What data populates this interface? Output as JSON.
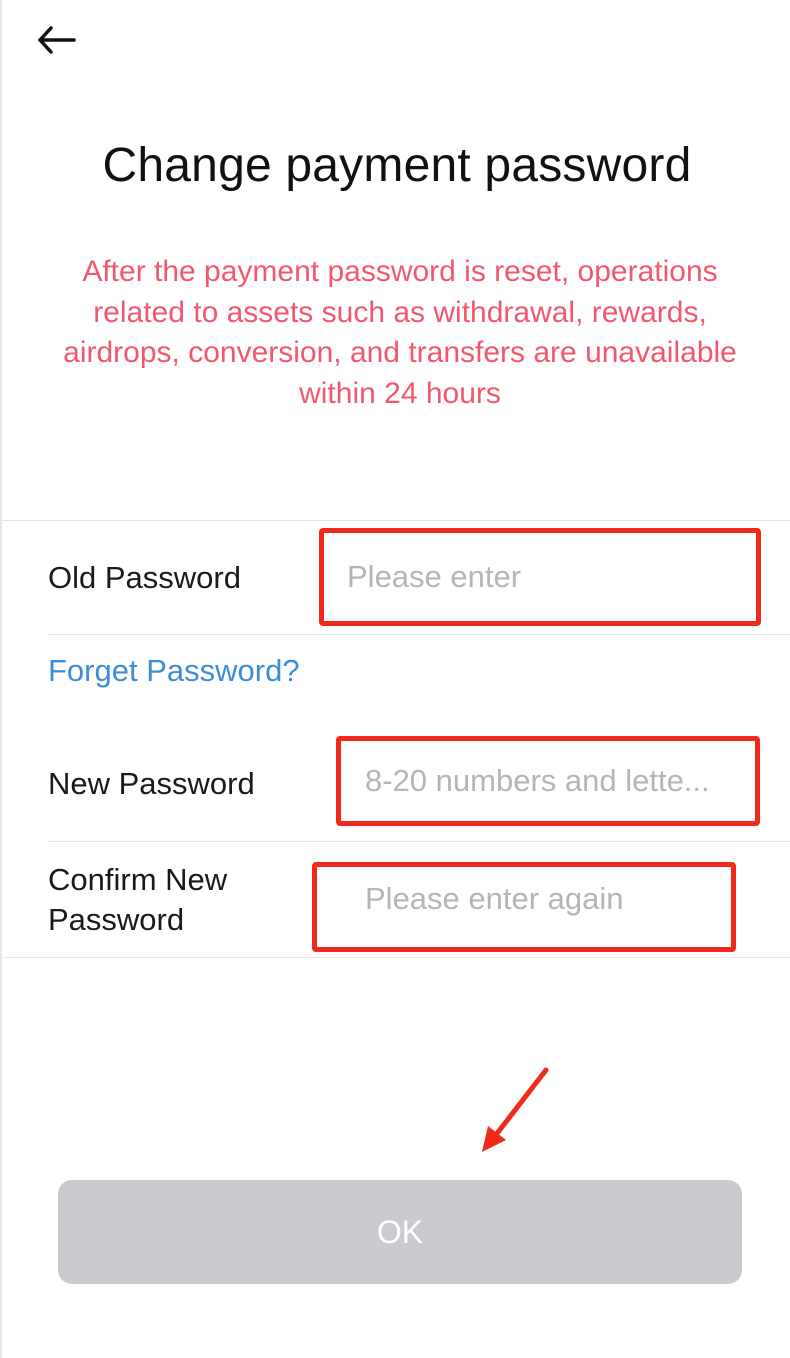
{
  "header": {
    "back_icon": "arrow-left-icon",
    "title": "Change payment password"
  },
  "notice": {
    "text": "After the payment password is reset, operations related to assets such as withdrawal, rewards, airdrops, conversion, and transfers are unavailable within 24 hours",
    "color": "#f2586b"
  },
  "form": {
    "old_password": {
      "label": "Old Password",
      "placeholder": "Please enter",
      "value": ""
    },
    "forgot_link": "Forget Password?",
    "new_password": {
      "label": "New Password",
      "placeholder": "8-20 numbers and lette...",
      "value": ""
    },
    "confirm_password": {
      "label_line1": "Confirm New",
      "label_line2": "Password",
      "placeholder": "Please enter again",
      "value": ""
    }
  },
  "actions": {
    "ok_label": "OK"
  },
  "colors": {
    "highlight_box": "#f0291a",
    "link": "#3d8ed6",
    "button_disabled": "#cbcbcf"
  }
}
